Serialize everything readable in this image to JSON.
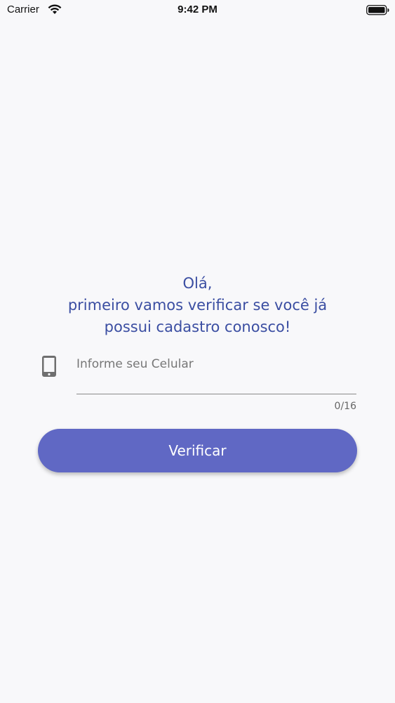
{
  "status_bar": {
    "carrier": "Carrier",
    "time": "9:42 PM"
  },
  "greeting": {
    "line1": "Olá,",
    "line2": "primeiro vamos verificar se você já",
    "line3": "possui cadastro conosco!"
  },
  "phone_input": {
    "placeholder": "Informe seu Celular",
    "value": "",
    "counter": "0/16"
  },
  "verify_button": {
    "label": "Verificar"
  },
  "colors": {
    "accent": "#6068c4",
    "heading": "#3b4ea2",
    "background": "#f8f8fa"
  },
  "icons": {
    "phone": "smartphone-icon",
    "wifi": "wifi-icon",
    "battery": "battery-icon"
  }
}
